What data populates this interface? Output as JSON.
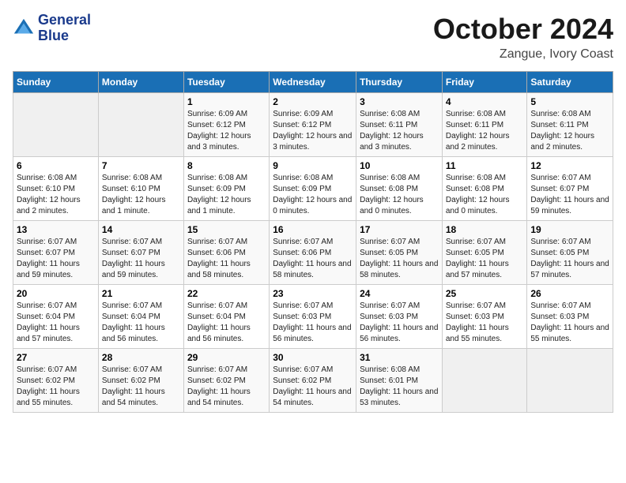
{
  "header": {
    "logo_line1": "General",
    "logo_line2": "Blue",
    "month": "October 2024",
    "location": "Zangue, Ivory Coast"
  },
  "weekdays": [
    "Sunday",
    "Monday",
    "Tuesday",
    "Wednesday",
    "Thursday",
    "Friday",
    "Saturday"
  ],
  "weeks": [
    [
      {
        "day": "",
        "info": ""
      },
      {
        "day": "",
        "info": ""
      },
      {
        "day": "1",
        "info": "Sunrise: 6:09 AM\nSunset: 6:12 PM\nDaylight: 12 hours and 3 minutes."
      },
      {
        "day": "2",
        "info": "Sunrise: 6:09 AM\nSunset: 6:12 PM\nDaylight: 12 hours and 3 minutes."
      },
      {
        "day": "3",
        "info": "Sunrise: 6:08 AM\nSunset: 6:11 PM\nDaylight: 12 hours and 3 minutes."
      },
      {
        "day": "4",
        "info": "Sunrise: 6:08 AM\nSunset: 6:11 PM\nDaylight: 12 hours and 2 minutes."
      },
      {
        "day": "5",
        "info": "Sunrise: 6:08 AM\nSunset: 6:11 PM\nDaylight: 12 hours and 2 minutes."
      }
    ],
    [
      {
        "day": "6",
        "info": "Sunrise: 6:08 AM\nSunset: 6:10 PM\nDaylight: 12 hours and 2 minutes."
      },
      {
        "day": "7",
        "info": "Sunrise: 6:08 AM\nSunset: 6:10 PM\nDaylight: 12 hours and 1 minute."
      },
      {
        "day": "8",
        "info": "Sunrise: 6:08 AM\nSunset: 6:09 PM\nDaylight: 12 hours and 1 minute."
      },
      {
        "day": "9",
        "info": "Sunrise: 6:08 AM\nSunset: 6:09 PM\nDaylight: 12 hours and 0 minutes."
      },
      {
        "day": "10",
        "info": "Sunrise: 6:08 AM\nSunset: 6:08 PM\nDaylight: 12 hours and 0 minutes."
      },
      {
        "day": "11",
        "info": "Sunrise: 6:08 AM\nSunset: 6:08 PM\nDaylight: 12 hours and 0 minutes."
      },
      {
        "day": "12",
        "info": "Sunrise: 6:07 AM\nSunset: 6:07 PM\nDaylight: 11 hours and 59 minutes."
      }
    ],
    [
      {
        "day": "13",
        "info": "Sunrise: 6:07 AM\nSunset: 6:07 PM\nDaylight: 11 hours and 59 minutes."
      },
      {
        "day": "14",
        "info": "Sunrise: 6:07 AM\nSunset: 6:07 PM\nDaylight: 11 hours and 59 minutes."
      },
      {
        "day": "15",
        "info": "Sunrise: 6:07 AM\nSunset: 6:06 PM\nDaylight: 11 hours and 58 minutes."
      },
      {
        "day": "16",
        "info": "Sunrise: 6:07 AM\nSunset: 6:06 PM\nDaylight: 11 hours and 58 minutes."
      },
      {
        "day": "17",
        "info": "Sunrise: 6:07 AM\nSunset: 6:05 PM\nDaylight: 11 hours and 58 minutes."
      },
      {
        "day": "18",
        "info": "Sunrise: 6:07 AM\nSunset: 6:05 PM\nDaylight: 11 hours and 57 minutes."
      },
      {
        "day": "19",
        "info": "Sunrise: 6:07 AM\nSunset: 6:05 PM\nDaylight: 11 hours and 57 minutes."
      }
    ],
    [
      {
        "day": "20",
        "info": "Sunrise: 6:07 AM\nSunset: 6:04 PM\nDaylight: 11 hours and 57 minutes."
      },
      {
        "day": "21",
        "info": "Sunrise: 6:07 AM\nSunset: 6:04 PM\nDaylight: 11 hours and 56 minutes."
      },
      {
        "day": "22",
        "info": "Sunrise: 6:07 AM\nSunset: 6:04 PM\nDaylight: 11 hours and 56 minutes."
      },
      {
        "day": "23",
        "info": "Sunrise: 6:07 AM\nSunset: 6:03 PM\nDaylight: 11 hours and 56 minutes."
      },
      {
        "day": "24",
        "info": "Sunrise: 6:07 AM\nSunset: 6:03 PM\nDaylight: 11 hours and 56 minutes."
      },
      {
        "day": "25",
        "info": "Sunrise: 6:07 AM\nSunset: 6:03 PM\nDaylight: 11 hours and 55 minutes."
      },
      {
        "day": "26",
        "info": "Sunrise: 6:07 AM\nSunset: 6:03 PM\nDaylight: 11 hours and 55 minutes."
      }
    ],
    [
      {
        "day": "27",
        "info": "Sunrise: 6:07 AM\nSunset: 6:02 PM\nDaylight: 11 hours and 55 minutes."
      },
      {
        "day": "28",
        "info": "Sunrise: 6:07 AM\nSunset: 6:02 PM\nDaylight: 11 hours and 54 minutes."
      },
      {
        "day": "29",
        "info": "Sunrise: 6:07 AM\nSunset: 6:02 PM\nDaylight: 11 hours and 54 minutes."
      },
      {
        "day": "30",
        "info": "Sunrise: 6:07 AM\nSunset: 6:02 PM\nDaylight: 11 hours and 54 minutes."
      },
      {
        "day": "31",
        "info": "Sunrise: 6:08 AM\nSunset: 6:01 PM\nDaylight: 11 hours and 53 minutes."
      },
      {
        "day": "",
        "info": ""
      },
      {
        "day": "",
        "info": ""
      }
    ]
  ]
}
